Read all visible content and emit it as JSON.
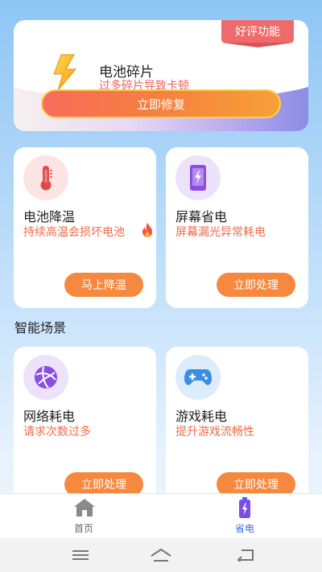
{
  "hero": {
    "badge": "好评功能",
    "title": "电池碎片",
    "subtitle": "过多碎片导致卡顿",
    "button": "立即修复"
  },
  "cards_top": [
    {
      "title": "电池降温",
      "subtitle": "持续高温会损坏电池",
      "button": "马上降温",
      "icon": "thermometer-icon"
    },
    {
      "title": "屏幕省电",
      "subtitle": "屏幕漏光异常耗电",
      "button": "立即处理",
      "icon": "phone-bolt-icon"
    }
  ],
  "section": {
    "title": "智能场景"
  },
  "cards_bottom": [
    {
      "title": "网络耗电",
      "subtitle": "请求次数过多",
      "button": "立即处理",
      "icon": "globe-icon"
    },
    {
      "title": "游戏耗电",
      "subtitle": "提升游戏流畅性",
      "button": "立即处理",
      "icon": "gamepad-icon"
    }
  ],
  "tabs": [
    {
      "label": "首页",
      "icon": "home-icon",
      "active": false
    },
    {
      "label": "省电",
      "icon": "battery-bolt-icon",
      "active": true
    }
  ],
  "colors": {
    "accent_orange": "#f6883f",
    "warning_red": "#f06262",
    "active_tab": "#3b6be6"
  }
}
